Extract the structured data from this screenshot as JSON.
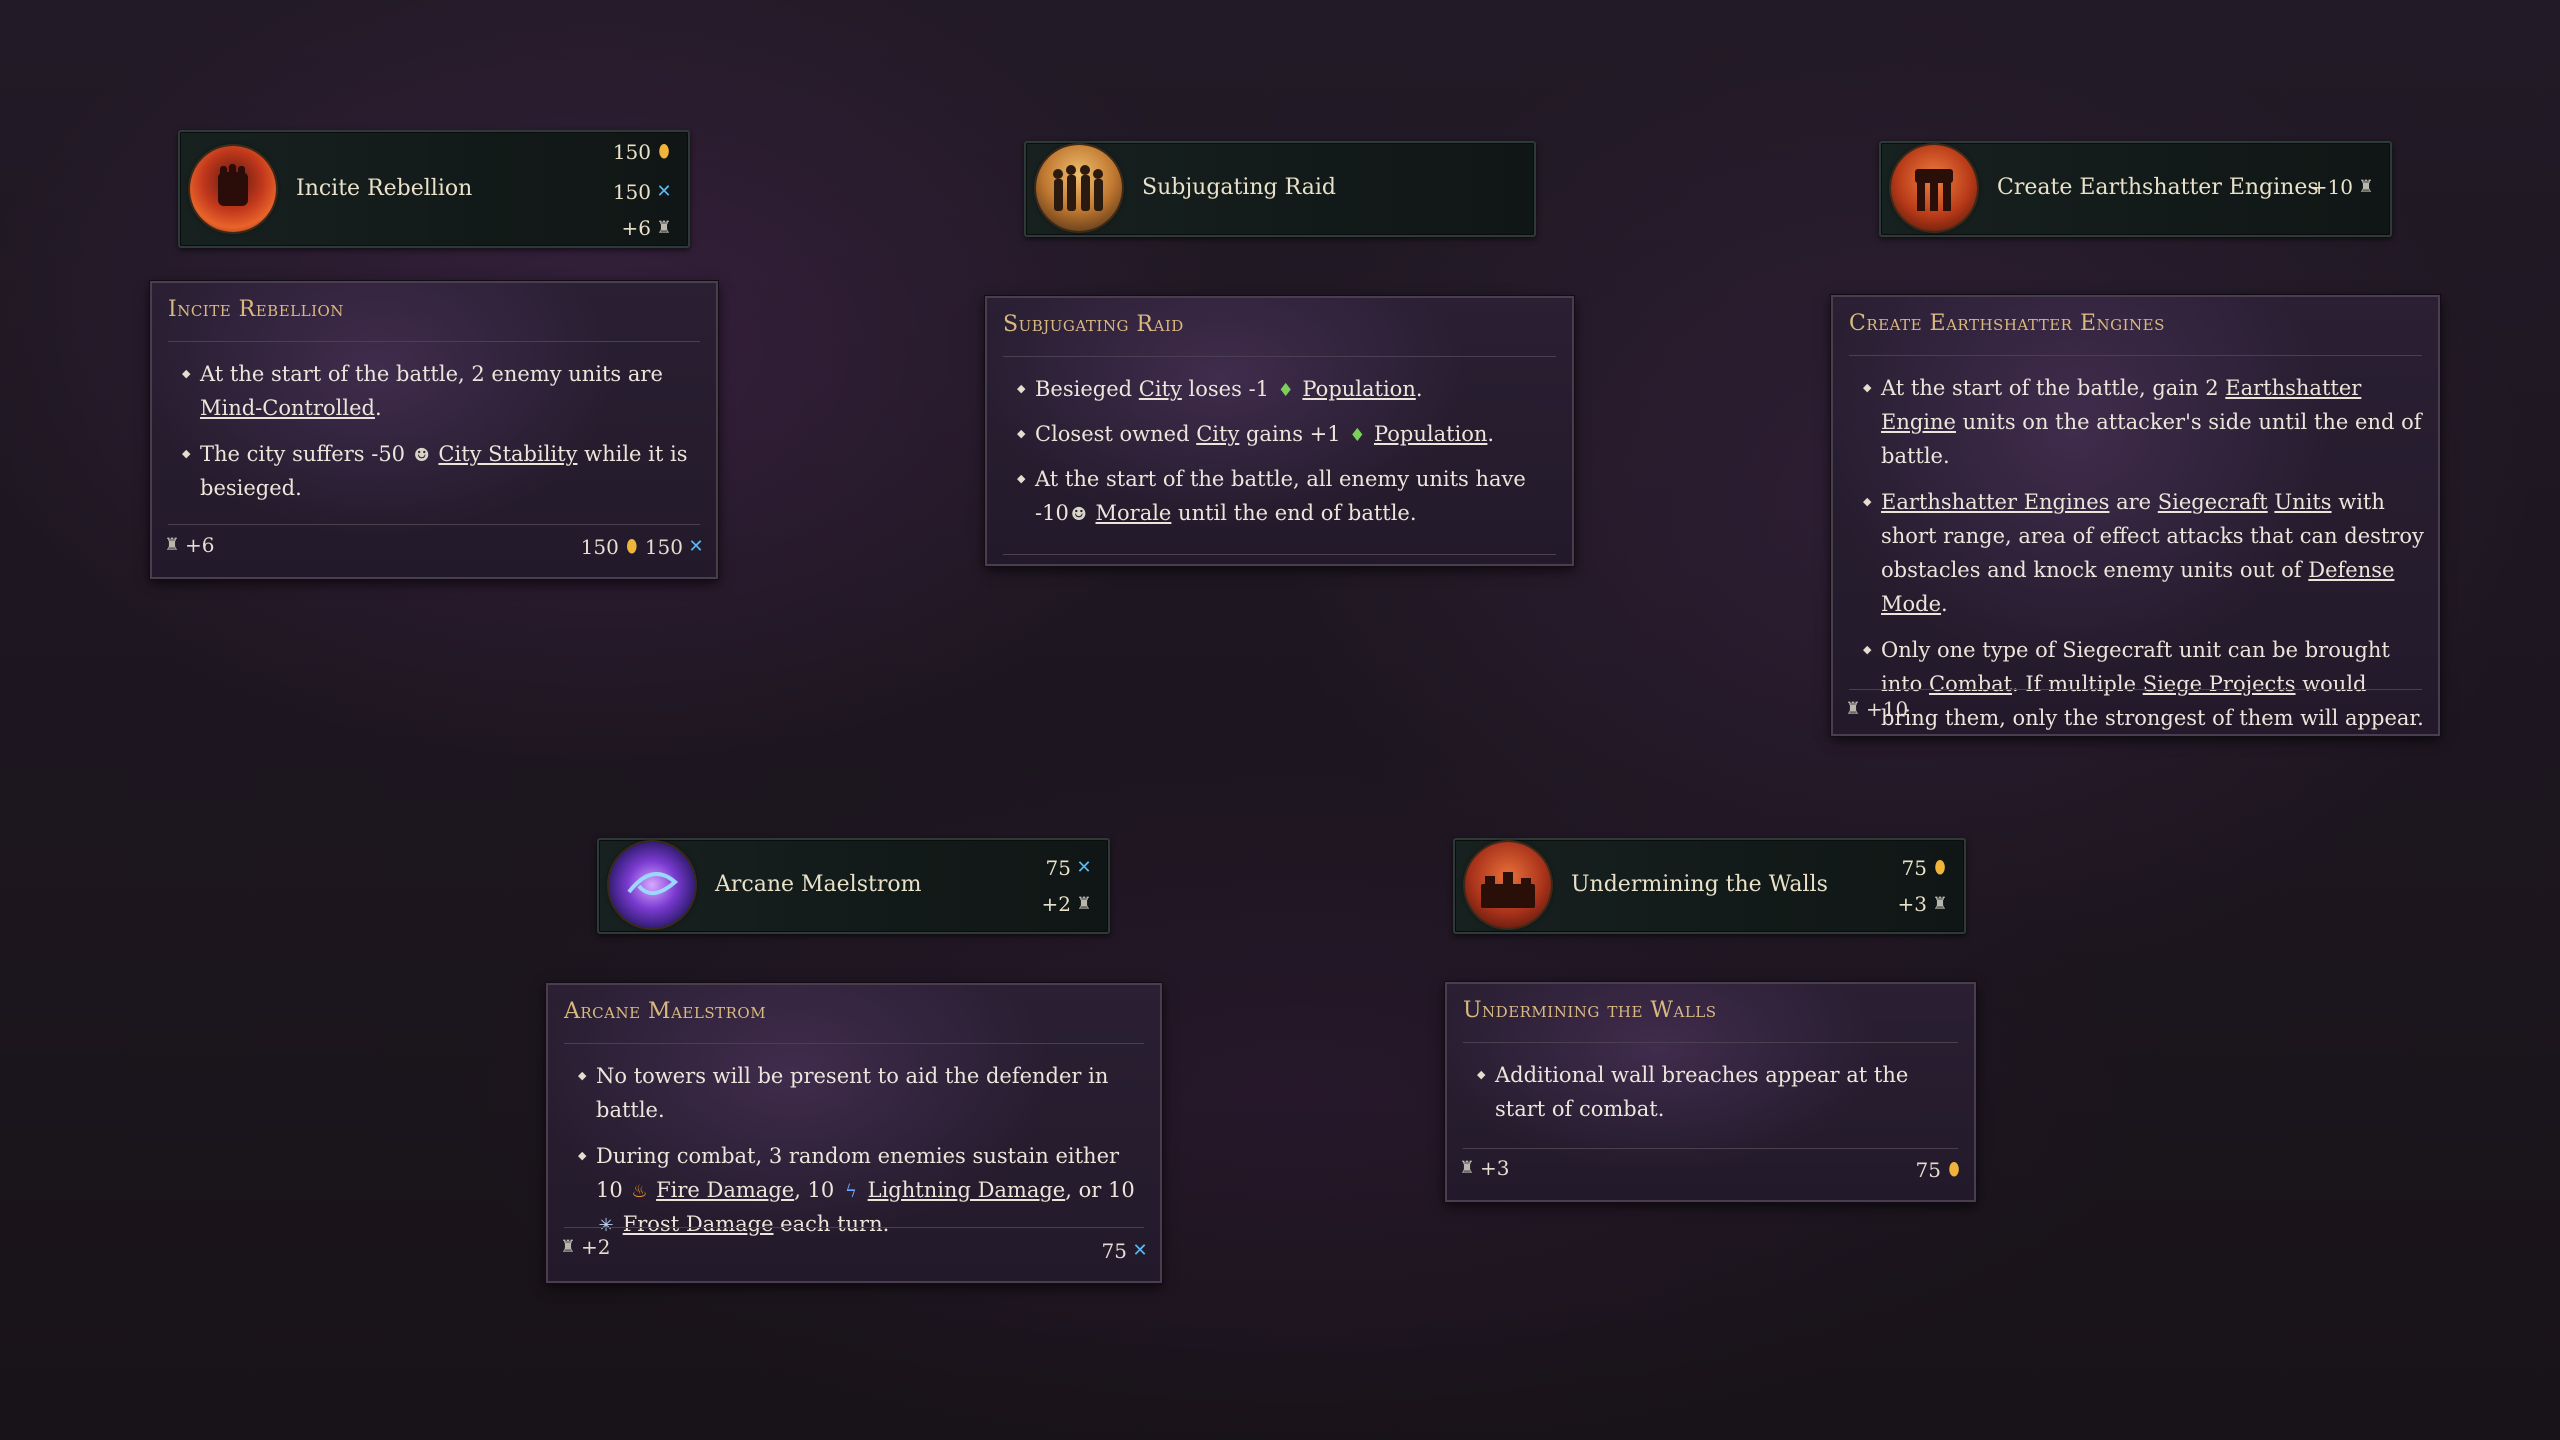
{
  "colors": {
    "gold_icon": "#f0b43a",
    "mana_icon": "#5ab8f0",
    "title_gold": "#d9b980"
  },
  "icons": {
    "gold": "gold-dust-icon",
    "mana": "mana-icon",
    "siege": "siege-progress-icon",
    "population": "population-icon",
    "morale": "morale-icon",
    "fire": "fire-icon",
    "lightning": "lightning-icon",
    "frost": "frost-icon"
  },
  "projects": {
    "incite": {
      "title": "Incite Rebellion",
      "gold": "150",
      "mana": "150",
      "siege": "+6"
    },
    "raid": {
      "title": "Subjugating Raid"
    },
    "engines": {
      "title": "Create Earthshatter Engines",
      "siege": "+10"
    },
    "arcane": {
      "title": "Arcane Maelstrom",
      "mana": "75",
      "siege": "+2"
    },
    "walls": {
      "title": "Undermining the Walls",
      "gold": "75",
      "siege": "+3"
    }
  },
  "tooltips": {
    "incite": {
      "title": "Incite Rebellion",
      "b1_a": "At the start of the battle, 2 enemy units are ",
      "b1_link": "Mind-Controlled",
      "b1_b": ".",
      "b2_a": "The city suffers -50 ",
      "b2_link": "City Stability",
      "b2_b": " while it is besieged.",
      "foot_siege": "+6",
      "foot_gold": "150",
      "foot_mana": "150"
    },
    "raid": {
      "title": "Subjugating Raid",
      "b1_a": "Besieged ",
      "b1_link1": "City",
      "b1_b": " loses -1 ",
      "b1_link2": "Population",
      "b1_c": ".",
      "b2_a": "Closest owned ",
      "b2_link1": "City",
      "b2_b": " gains +1 ",
      "b2_link2": "Population",
      "b2_c": ".",
      "b3_a": "At the start of the battle, all enemy units have -10",
      "b3_link": "Morale",
      "b3_b": " until the end of battle."
    },
    "engines": {
      "title": "Create Earthshatter Engines",
      "b1_a": "At the start of the battle, gain 2 ",
      "b1_link": "Earthshatter Engine",
      "b1_b": " units on the attacker's side until the end of battle.",
      "b2_link1": "Earthshatter Engines",
      "b2_a": " are ",
      "b2_link2": "Siegecraft",
      "b2_sp": " ",
      "b2_link3": "Units",
      "b2_b": " with short range, area of effect attacks that can destroy obstacles and knock enemy units out of ",
      "b2_link4": "Defense Mode",
      "b2_c": ".",
      "b3_a": "Only one type of Siegecraft unit can be brought into ",
      "b3_link1": "Combat",
      "b3_b": ". If multiple ",
      "b3_link2": "Siege Projects",
      "b3_c": " would bring them, only the strongest of them will appear.",
      "foot_siege": "+10"
    },
    "arcane": {
      "title": "Arcane Maelstrom",
      "b1": "No towers will be present to aid the defender in battle.",
      "b2_a": "During combat, 3 random enemies sustain either 10 ",
      "b2_link1": "Fire Damage",
      "b2_b": ", 10 ",
      "b2_link2": "Lightning Damage",
      "b2_c": ", or 10 ",
      "b2_link3": "Frost Damage",
      "b2_d": " each turn.",
      "foot_siege": "+2",
      "foot_mana": "75"
    },
    "walls": {
      "title": "Undermining the Walls",
      "b1": "Additional wall breaches appear at the start of combat.",
      "foot_siege": "+3",
      "foot_gold": "75"
    }
  }
}
